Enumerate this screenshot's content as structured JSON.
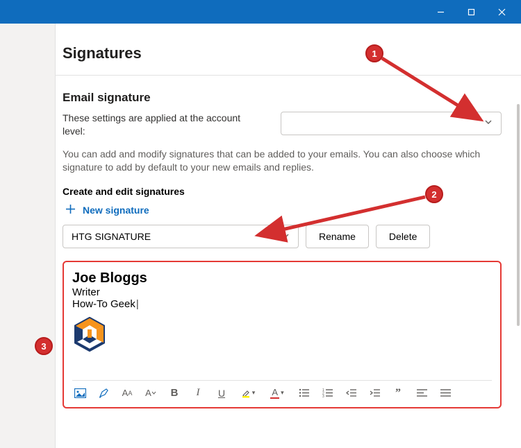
{
  "window": {
    "titlebar_color": "#0f6cbd"
  },
  "page": {
    "title": "Signatures"
  },
  "email_sig": {
    "heading": "Email signature",
    "account_level_label": "These settings are applied at the account level:",
    "description": "You can add and modify signatures that can be added to your emails. You can also choose which signature to add by default to your new emails and replies.",
    "create_edit_label": "Create and edit signatures",
    "new_signature_label": "New signature"
  },
  "signature_select": {
    "value": "HTG SIGNATURE"
  },
  "buttons": {
    "rename": "Rename",
    "delete": "Delete"
  },
  "preview": {
    "name": "Joe Bloggs",
    "role": "Writer",
    "org": "How-To Geek"
  },
  "annotations": {
    "b1": "1",
    "b2": "2",
    "b3": "3"
  }
}
